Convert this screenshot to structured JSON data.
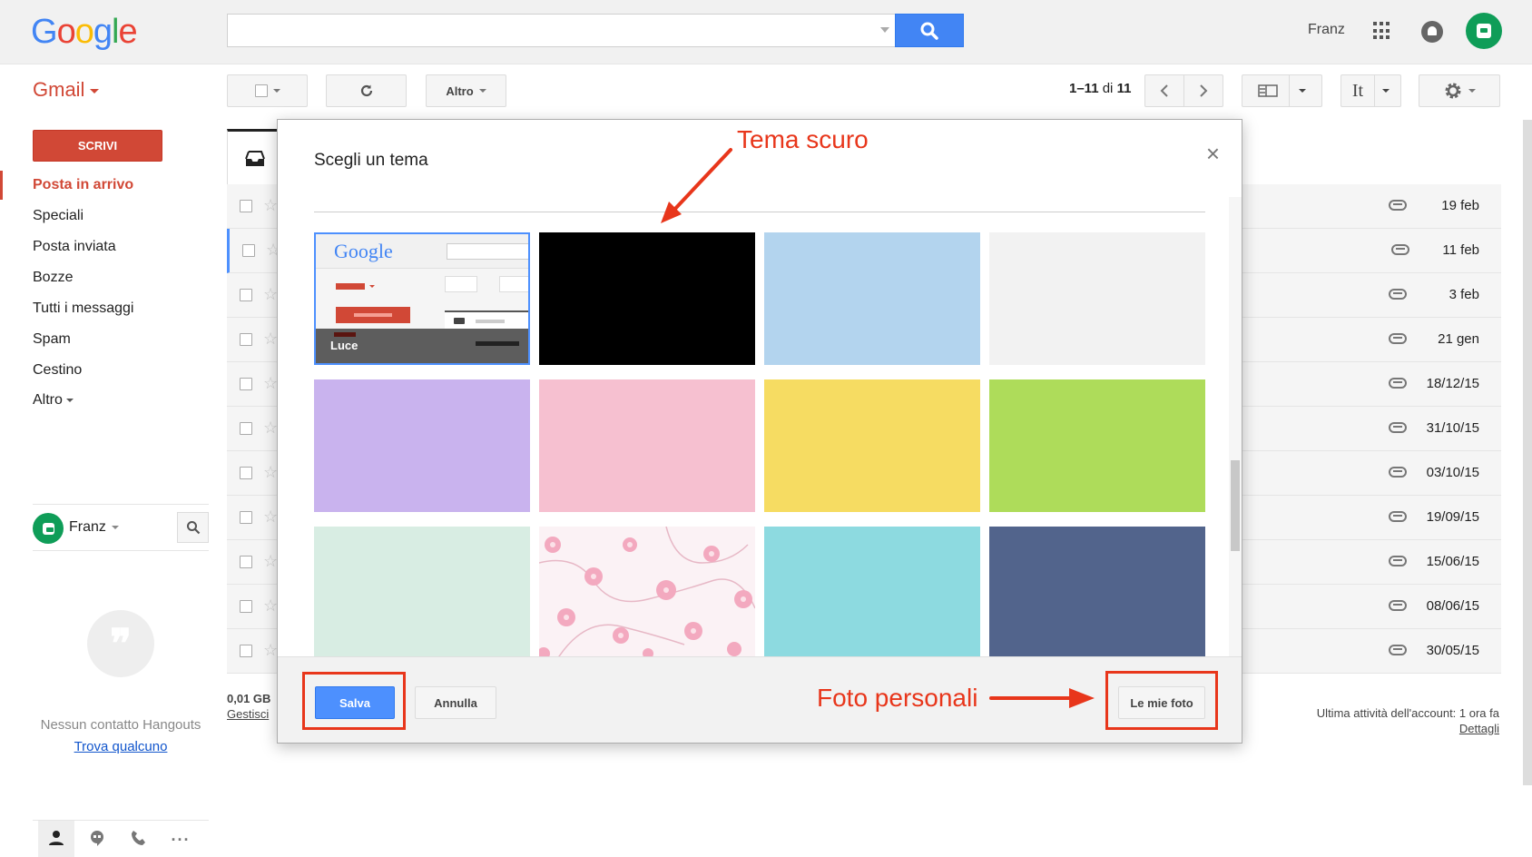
{
  "header": {
    "logo": "Google",
    "user_name": "Franz"
  },
  "toolbar": {
    "app_label": "Gmail",
    "more_label": "Altro",
    "pager_range": "1–11",
    "pager_of": "di",
    "pager_total": "11",
    "input_tools_label": "It"
  },
  "sidebar": {
    "compose_label": "SCRIVI",
    "items": [
      {
        "label": "Posta in arrivo"
      },
      {
        "label": "Speciali"
      },
      {
        "label": "Posta inviata"
      },
      {
        "label": "Bozze"
      },
      {
        "label": "Tutti i messaggi"
      },
      {
        "label": "Spam"
      },
      {
        "label": "Cestino"
      },
      {
        "label": "Altro"
      }
    ]
  },
  "hangouts": {
    "user_name": "Franz",
    "empty_text": "Nessun contatto Hangouts",
    "find_link": "Trova qualcuno"
  },
  "mail_list": {
    "dates": [
      "19 feb",
      "11 feb",
      "3 feb",
      "21 gen",
      "18/12/15",
      "31/10/15",
      "03/10/15",
      "19/09/15",
      "15/06/15",
      "08/06/15",
      "30/05/15"
    ]
  },
  "footer": {
    "storage": "0,01 GB",
    "manage_link": "Gestisci",
    "activity": "Ultima attività dell'account: 1 ora fa",
    "details_link": "Dettagli"
  },
  "theme_dialog": {
    "title": "Scegli un tema",
    "close_glyph": "×",
    "save_label": "Salva",
    "cancel_label": "Annulla",
    "my_photos_label": "Le mie foto",
    "preview": {
      "logo": "Google",
      "label": "Luce"
    },
    "colors": {
      "dark": "#000000",
      "light_blue": "#b3d4ee",
      "white_grey": "#f2f2f2",
      "lavender": "#c9b3ee",
      "pink": "#f6c0d0",
      "yellow": "#f6dc62",
      "green": "#aedc5a",
      "mint": "#d8ede3",
      "cyan": "#8ddae0",
      "navy": "#52648c"
    }
  },
  "annotations": {
    "dark_theme": "Tema scuro",
    "personal_photos": "Foto personali"
  }
}
